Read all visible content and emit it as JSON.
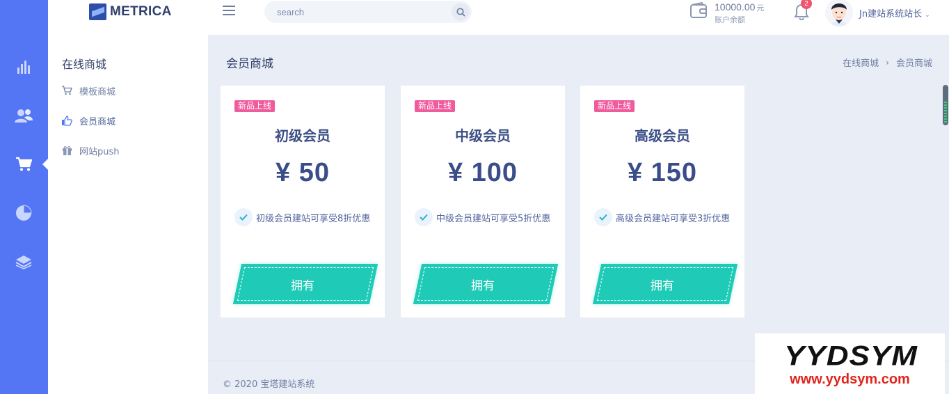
{
  "brand": {
    "name": "METRICA"
  },
  "search": {
    "placeholder": "search"
  },
  "account": {
    "balance": "10000.00",
    "unit": "元",
    "balance_label": "账户余额"
  },
  "notifications": {
    "count": "2"
  },
  "user": {
    "name": "Jn建站系统站长"
  },
  "rail": {
    "icons": [
      "bar-chart-icon",
      "users-icon",
      "cart-icon",
      "pie-chart-icon",
      "layers-icon"
    ],
    "active": "cart-icon"
  },
  "submenu": {
    "title": "在线商城",
    "items": [
      {
        "label": "模板商城",
        "icon": "cart-icon"
      },
      {
        "label": "会员商城",
        "icon": "thumbs-up-icon"
      },
      {
        "label": "网站push",
        "icon": "gift-icon"
      }
    ]
  },
  "page": {
    "title": "会员商城",
    "breadcrumb": [
      "在线商城",
      "会员商城"
    ]
  },
  "plans": [
    {
      "tag": "新品上线",
      "name": "初级会员",
      "price": "¥ 50",
      "feature": "初级会员建站可享受8折优惠",
      "button": "拥有"
    },
    {
      "tag": "新品上线",
      "name": "中级会员",
      "price": "¥ 100",
      "feature": "中级会员建站可享受5折优惠",
      "button": "拥有"
    },
    {
      "tag": "新品上线",
      "name": "高级会员",
      "price": "¥ 150",
      "feature": "高级会员建站可享受3折优惠",
      "button": "拥有"
    }
  ],
  "footer": {
    "text": "© 2020 宝塔建站系统"
  },
  "watermark": {
    "title": "YYDSYM",
    "url": "www.yydsym.com"
  },
  "colors": {
    "rail": "#5476f5",
    "background": "#e9eef6",
    "accent": "#1fcbb7",
    "tag": "#ef5b9c",
    "badge": "#f1556c"
  }
}
